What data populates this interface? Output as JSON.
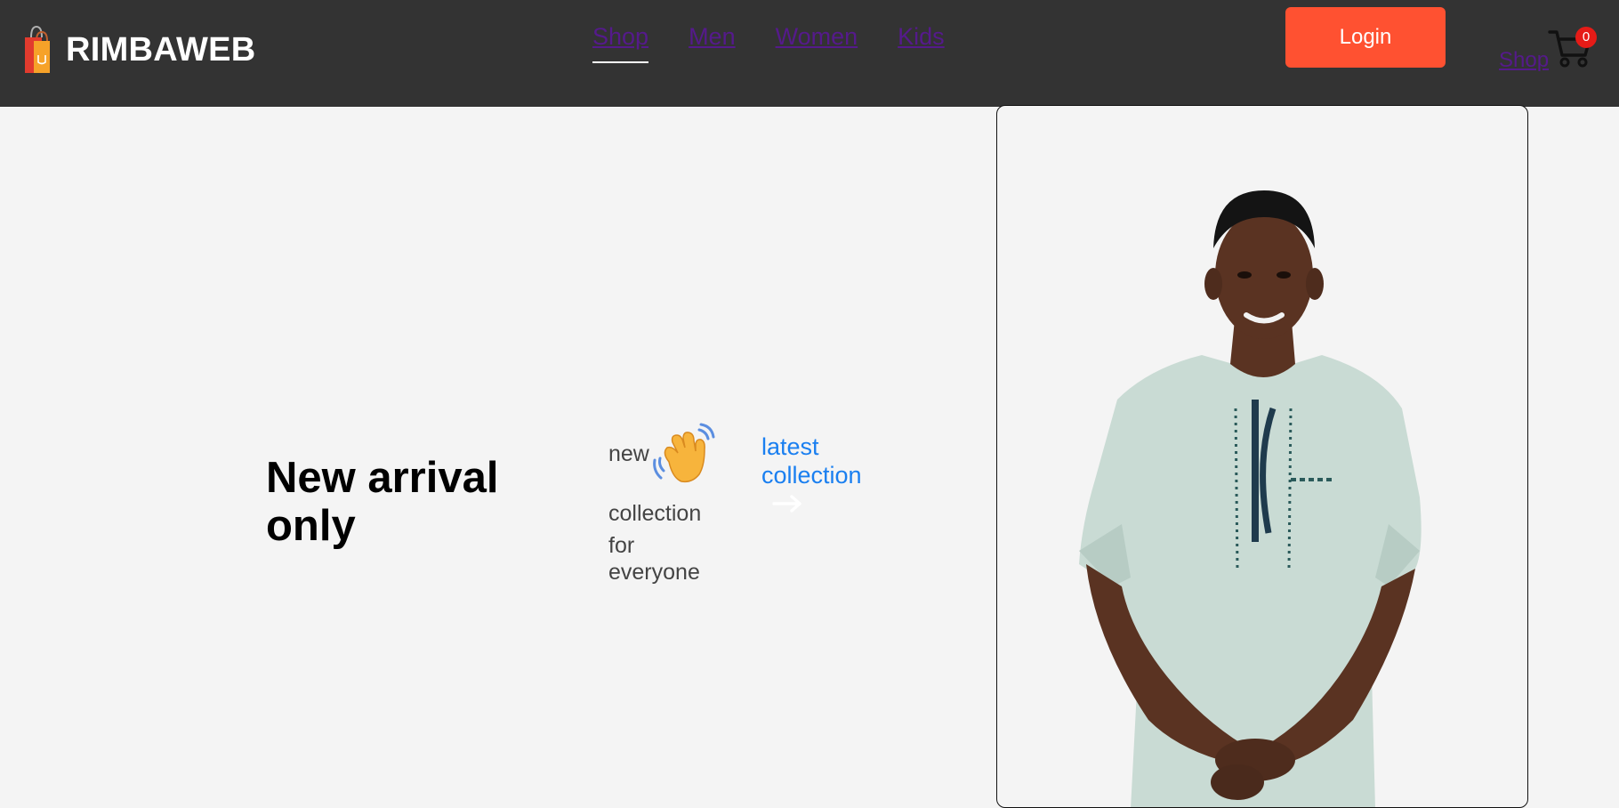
{
  "brand": {
    "name": "RIMBAWEB",
    "icon": "shopping-bag-icon"
  },
  "nav": {
    "items": [
      {
        "label": "Shop",
        "active": true
      },
      {
        "label": "Men",
        "active": false
      },
      {
        "label": "Women",
        "active": false
      },
      {
        "label": "Kids",
        "active": false
      }
    ]
  },
  "header": {
    "login_label": "Login",
    "cart_shop_label": "Shop",
    "cart_icon": "cart-icon",
    "cart_count": "0"
  },
  "hero": {
    "title": "New arrival only",
    "tag_new": "new",
    "tag_icon": "waving-hand-icon",
    "tag_collection": "collection",
    "tag_for": "for",
    "tag_everyone": "everyone",
    "latest_label": "latest collection",
    "arrow_icon": "arrow-right-icon",
    "image_icon": "model-photo"
  },
  "colors": {
    "header_bg": "#333333",
    "page_bg": "#f4f4f4",
    "login_bg": "#ff5131",
    "nav_link": "#551a8b",
    "latest_link": "#1a7ff0",
    "badge": "#e61b17"
  }
}
